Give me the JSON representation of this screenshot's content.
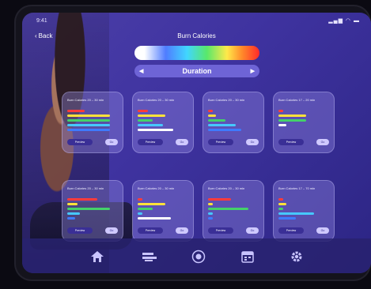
{
  "status": {
    "time": "9:41",
    "indicators": "▂▄▆ ◠ ▬"
  },
  "header": {
    "back_label": "Back",
    "title": "Burn Calories"
  },
  "selector": {
    "label": "Duration"
  },
  "colors": {
    "red": "#ff3b3b",
    "yellow": "#ffe23a",
    "green": "#44d16a",
    "cyan": "#46c8ff",
    "blue": "#3e7bff",
    "white": "#ffffff"
  },
  "cards": [
    {
      "title": "Burn Calories 20 – 30 min",
      "preview": "Preview",
      "go": "Go",
      "bars": [
        {
          "color": "red",
          "level": 0.35
        },
        {
          "color": "yellow",
          "level": 0.85
        },
        {
          "color": "green",
          "level": 0.85
        },
        {
          "color": "cyan",
          "level": 0.85
        },
        {
          "color": "blue",
          "level": 0.85
        }
      ]
    },
    {
      "title": "Burn Calories 20 – 30 min",
      "preview": "Preview",
      "go": "Go",
      "bars": [
        {
          "color": "red",
          "level": 0.2
        },
        {
          "color": "yellow",
          "level": 0.55
        },
        {
          "color": "green",
          "level": 0.3
        },
        {
          "color": "cyan",
          "level": 0.5
        },
        {
          "color": "white",
          "level": 0.7
        }
      ]
    },
    {
      "title": "Burn Calories 20 – 30 min",
      "preview": "Preview",
      "go": "Go",
      "bars": [
        {
          "color": "red",
          "level": 0.1
        },
        {
          "color": "yellow",
          "level": 0.15
        },
        {
          "color": "green",
          "level": 0.35
        },
        {
          "color": "cyan",
          "level": 0.55
        },
        {
          "color": "blue",
          "level": 0.65
        }
      ]
    },
    {
      "title": "Burn Calories 17 – 20 min",
      "preview": "Preview",
      "go": "Go",
      "bars": [
        {
          "color": "red",
          "level": 0.1
        },
        {
          "color": "yellow",
          "level": 0.55
        },
        {
          "color": "green",
          "level": 0.55
        },
        {
          "color": "white",
          "level": 0.15
        }
      ]
    },
    {
      "title": "Burn Calories 20 – 30 min",
      "preview": "Preview",
      "go": "Go",
      "bars": [
        {
          "color": "red",
          "level": 0.6
        },
        {
          "color": "yellow",
          "level": 0.2
        },
        {
          "color": "green",
          "level": 0.85
        },
        {
          "color": "cyan",
          "level": 0.25
        },
        {
          "color": "blue",
          "level": 0.15
        }
      ]
    },
    {
      "title": "Burn Calories 20 – 30 min",
      "preview": "Preview",
      "go": "Go",
      "bars": [
        {
          "color": "red",
          "level": 0.1
        },
        {
          "color": "yellow",
          "level": 0.55
        },
        {
          "color": "green",
          "level": 0.3
        },
        {
          "color": "cyan",
          "level": 0.1
        },
        {
          "color": "white",
          "level": 0.65
        }
      ]
    },
    {
      "title": "Burn Calories 20 – 30 min",
      "preview": "Preview",
      "go": "Go",
      "bars": [
        {
          "color": "red",
          "level": 0.45
        },
        {
          "color": "yellow",
          "level": 0.1
        },
        {
          "color": "green",
          "level": 0.8
        },
        {
          "color": "cyan",
          "level": 0.1
        },
        {
          "color": "blue",
          "level": 0.1
        }
      ]
    },
    {
      "title": "Burn Calories 17 – 70 min",
      "preview": "Preview",
      "go": "Go",
      "bars": [
        {
          "color": "red",
          "level": 0.1
        },
        {
          "color": "yellow",
          "level": 0.15
        },
        {
          "color": "green",
          "level": 0.1
        },
        {
          "color": "cyan",
          "level": 0.7
        },
        {
          "color": "blue",
          "level": 0.35
        }
      ]
    }
  ],
  "nav": [
    {
      "icon": "home-icon"
    },
    {
      "icon": "workouts-icon"
    },
    {
      "icon": "record-icon"
    },
    {
      "icon": "calendar-icon"
    },
    {
      "icon": "gear-icon"
    }
  ]
}
